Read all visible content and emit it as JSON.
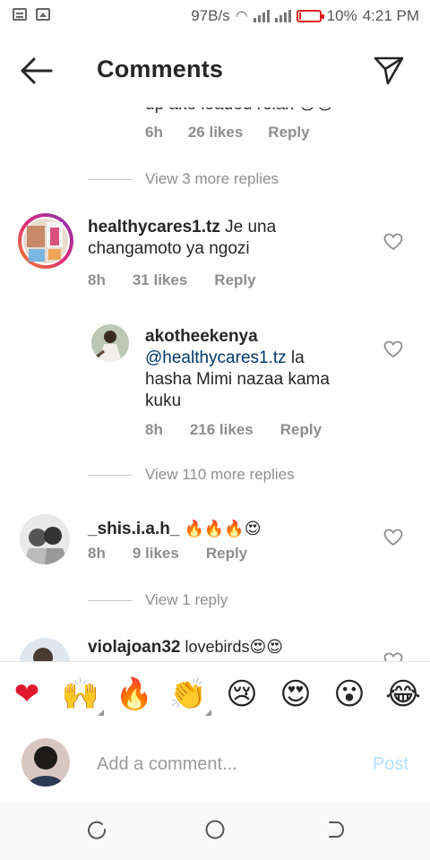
{
  "status_bar": {
    "speed": "97B/s",
    "battery_percent": "10%",
    "battery_level": 0.1,
    "time": "4:21 PM"
  },
  "header": {
    "title": "Comments",
    "back_icon": "arrow-left-icon",
    "send_icon": "paper-plane-icon"
  },
  "comments": {
    "partial": {
      "text": "up ake loaded relax 😍😍",
      "time": "6h",
      "likes": "26 likes",
      "reply": "Reply"
    },
    "view_more_1": "View 3 more replies",
    "c1": {
      "username": "healthycares1.tz",
      "text_line1": " Je una",
      "text_line2": "changamoto ya ngozi",
      "time": "8h",
      "likes": "31 likes",
      "reply": "Reply"
    },
    "r1": {
      "username": "akotheekenya",
      "mention": "@healthycares1.tz",
      "text_line1": " la",
      "text_line2": "hasha Mimi nazaa kama",
      "text_line3": "kuku",
      "time": "8h",
      "likes": "216 likes",
      "reply": "Reply"
    },
    "view_more_2": "View 110 more replies",
    "c2": {
      "username": "_shis.i.a.h_",
      "text": " 🔥🔥🔥😍",
      "time": "8h",
      "likes": "9 likes",
      "reply": "Reply"
    },
    "view_more_3": "View 1 reply",
    "c3": {
      "username": "violajoan32",
      "text": " lovebirds😍😍"
    }
  },
  "emoji_bar": [
    "❤",
    "🙌",
    "🔥",
    "👏",
    "😢",
    "😍",
    "😮",
    "😂"
  ],
  "composer": {
    "placeholder": "Add a comment...",
    "post_label": "Post"
  },
  "colors": {
    "link": "#00376b",
    "muted": "#8e8e8e",
    "post_disabled": "#b2dffc",
    "battery": "#e02020"
  }
}
